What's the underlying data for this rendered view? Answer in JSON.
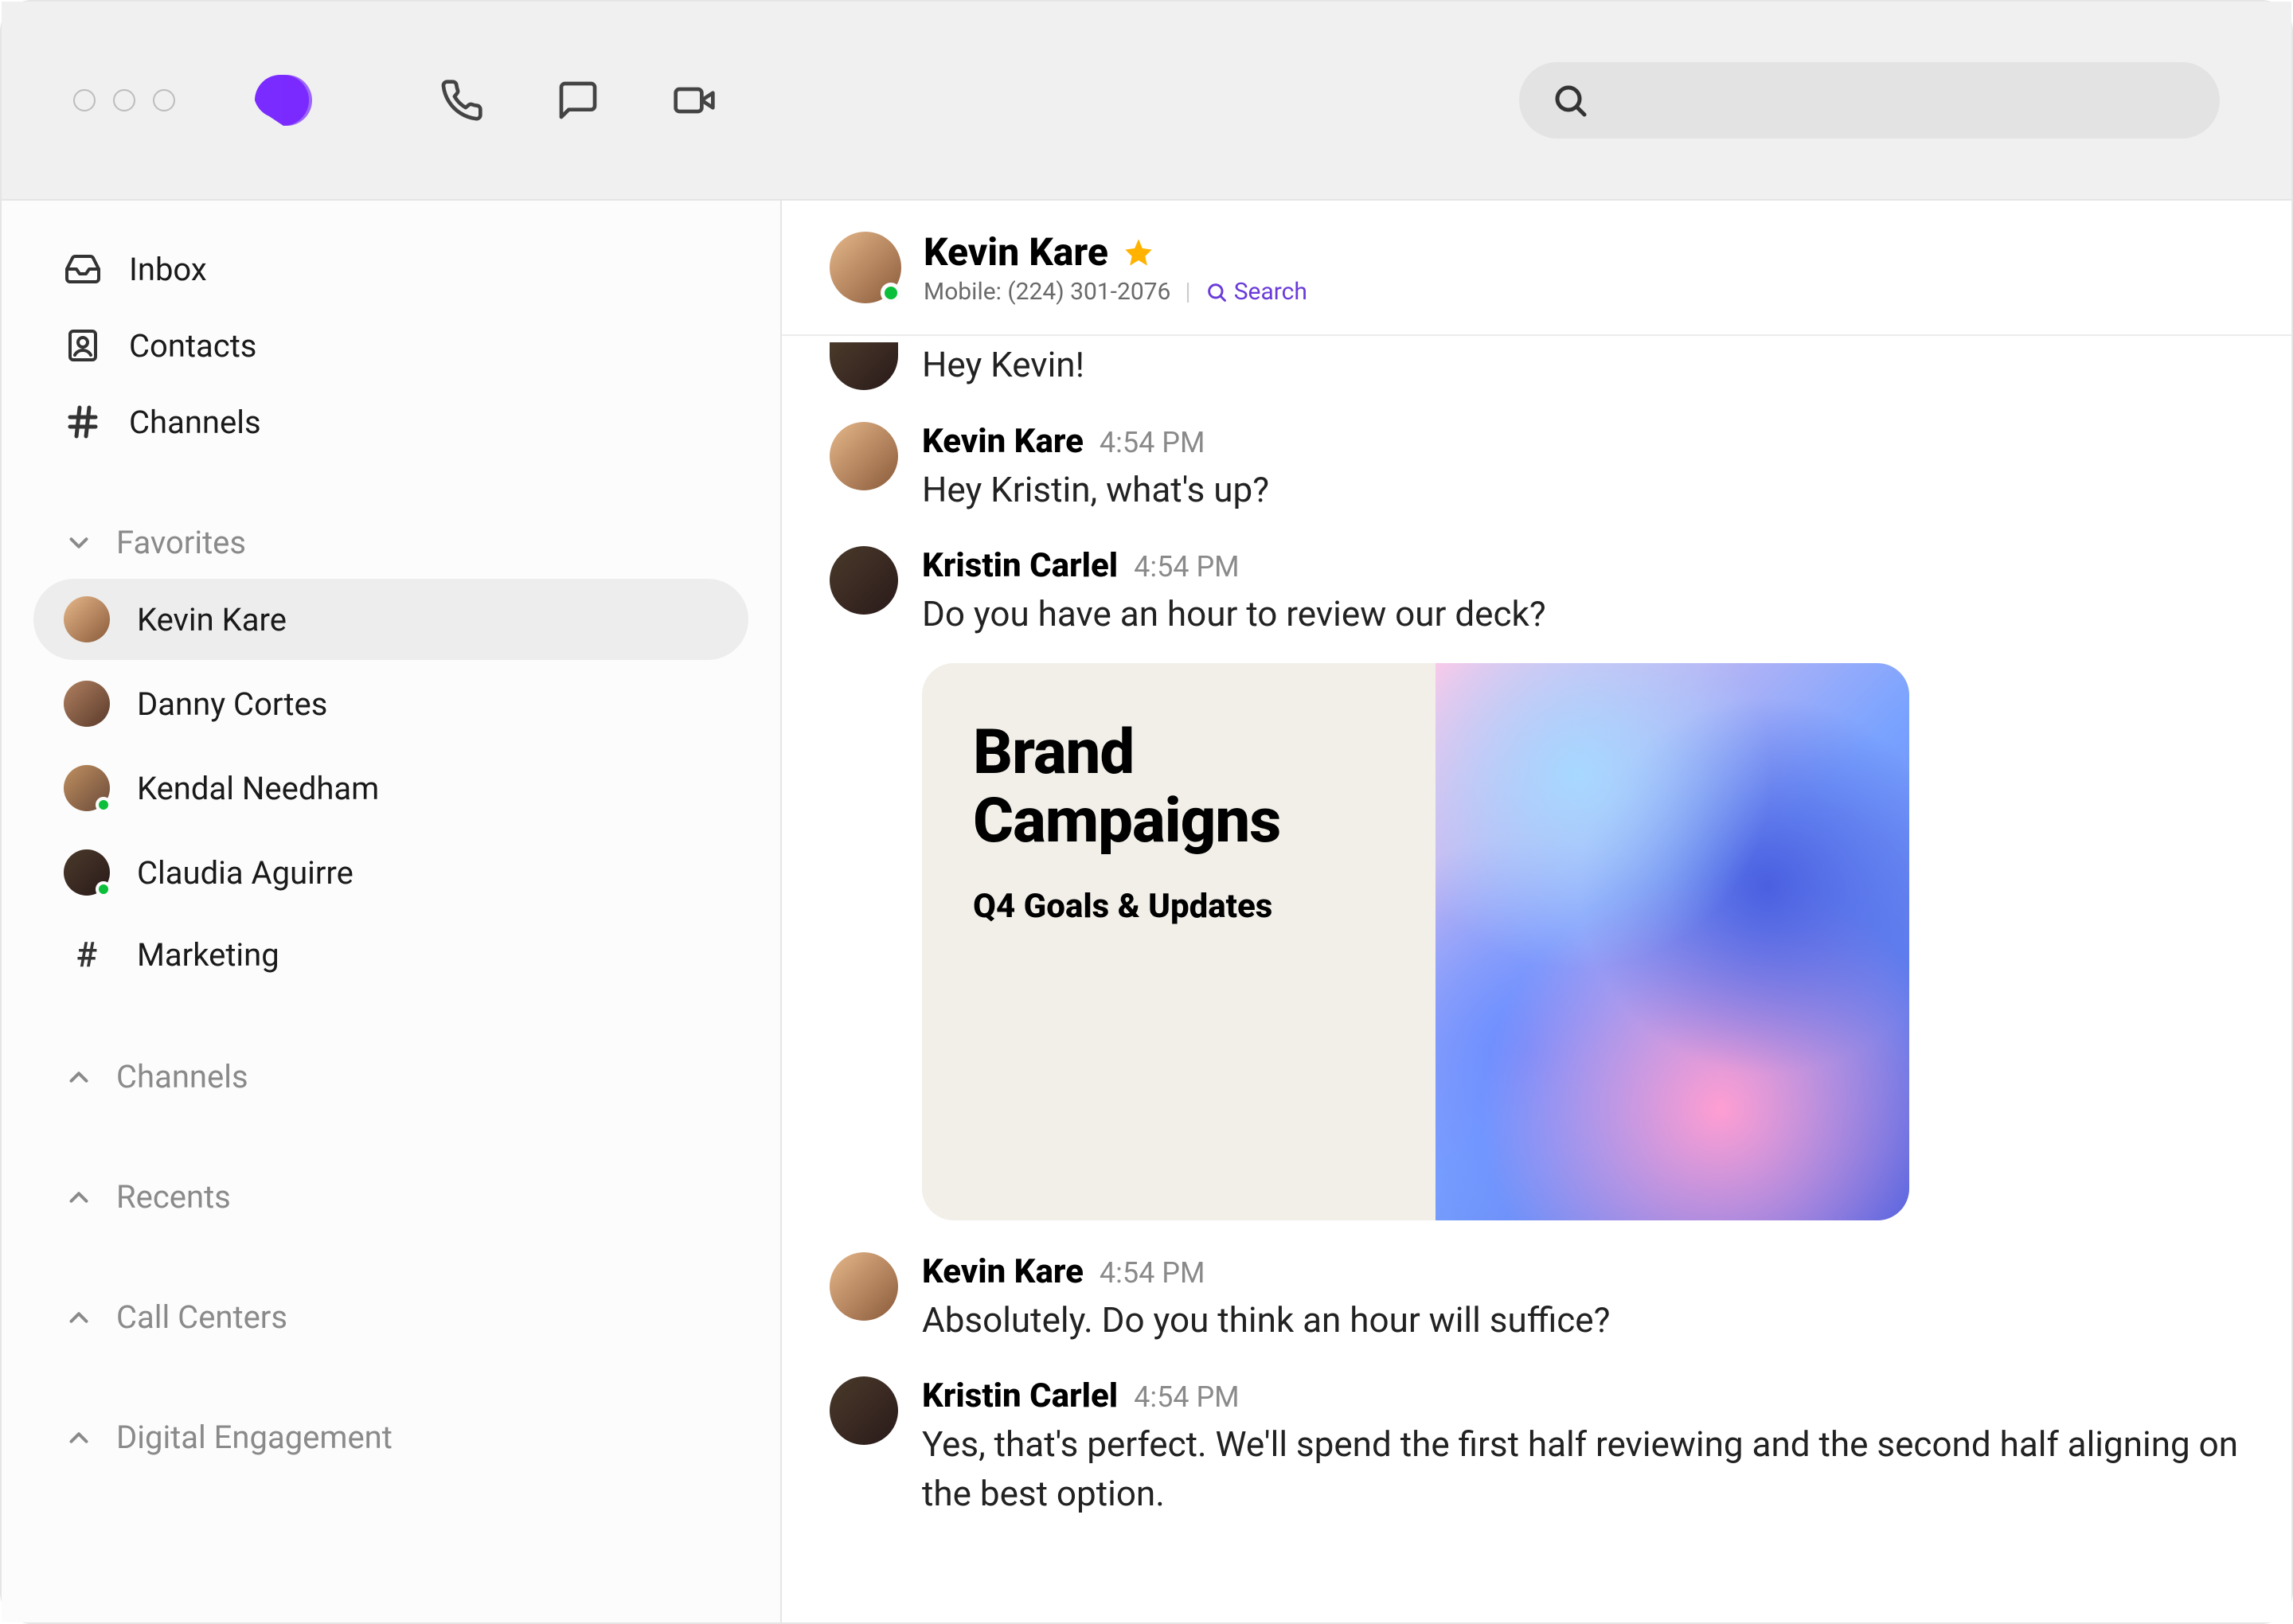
{
  "titlebar": {
    "search_placeholder": ""
  },
  "sidebar": {
    "primary": [
      {
        "label": "Inbox",
        "icon": "inbox"
      },
      {
        "label": "Contacts",
        "icon": "contacts"
      },
      {
        "label": "Channels",
        "icon": "hash"
      }
    ],
    "favorites_label": "Favorites",
    "favorites": [
      {
        "label": "Kevin Kare",
        "active": true,
        "presence": false,
        "avatar": "a1"
      },
      {
        "label": "Danny Cortes",
        "active": false,
        "presence": false,
        "avatar": "a2"
      },
      {
        "label": "Kendal Needham",
        "active": false,
        "presence": true,
        "avatar": "a3"
      },
      {
        "label": "Claudia Aguirre",
        "active": false,
        "presence": true,
        "avatar": "a4"
      },
      {
        "label": "Marketing",
        "active": false,
        "presence": false,
        "avatar": "hash"
      }
    ],
    "collapsed_sections": [
      "Channels",
      "Recents",
      "Call Centers",
      "Digital Engagement"
    ]
  },
  "conversation": {
    "header": {
      "name": "Kevin Kare",
      "starred": true,
      "phone_label": "Mobile: (224) 301-2076",
      "search_label": "Search"
    },
    "messages": [
      {
        "partial": true,
        "text": "Hey Kevin!",
        "avatar": "a4"
      },
      {
        "name": "Kevin Kare",
        "time": "4:54 PM",
        "text": "Hey Kristin, what's up?",
        "avatar": "a1"
      },
      {
        "name": "Kristin Carlel",
        "time": "4:54 PM",
        "text": "Do you have an hour to review our deck?",
        "avatar": "a4",
        "attachment": {
          "title": "Brand Campaigns",
          "subtitle": "Q4 Goals & Updates"
        }
      },
      {
        "name": "Kevin Kare",
        "time": "4:54 PM",
        "text": "Absolutely. Do you think an hour will suffice?",
        "avatar": "a1"
      },
      {
        "name": "Kristin Carlel",
        "time": "4:54 PM",
        "text": "Yes, that's perfect. We'll spend the first half reviewing and the second half aligning on the best option.",
        "avatar": "a4"
      }
    ]
  }
}
